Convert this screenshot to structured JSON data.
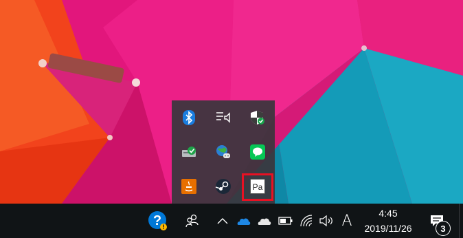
{
  "taskbar": {
    "background_color": "#101416",
    "clock": {
      "time": "4:45",
      "date": "2019/11/26"
    },
    "ime": {
      "label": "A"
    },
    "notifications": {
      "count": "3"
    },
    "icons": [
      "help-icon",
      "people-icon",
      "chevron-up-icon",
      "onedrive-icon",
      "onedrive-personal-icon",
      "battery-icon",
      "wifi-icon",
      "volume-icon",
      "action-center-icon"
    ]
  },
  "tray_flyout": {
    "background_color": "#3a363c",
    "icons": [
      [
        "bluetooth-icon",
        "display-settings-icon",
        "windows-security-icon"
      ],
      [
        "safely-remove-hardware-icon",
        "network-globe-icon",
        "line-messenger-icon"
      ],
      [
        "java-icon",
        "steam-icon",
        "pa-app-icon"
      ]
    ],
    "pa_label": "Pa",
    "highlight_color": "#e81123"
  },
  "wallpaper": {
    "description_colors": [
      "#f2431c",
      "#e0127a",
      "#19a7c2"
    ]
  }
}
